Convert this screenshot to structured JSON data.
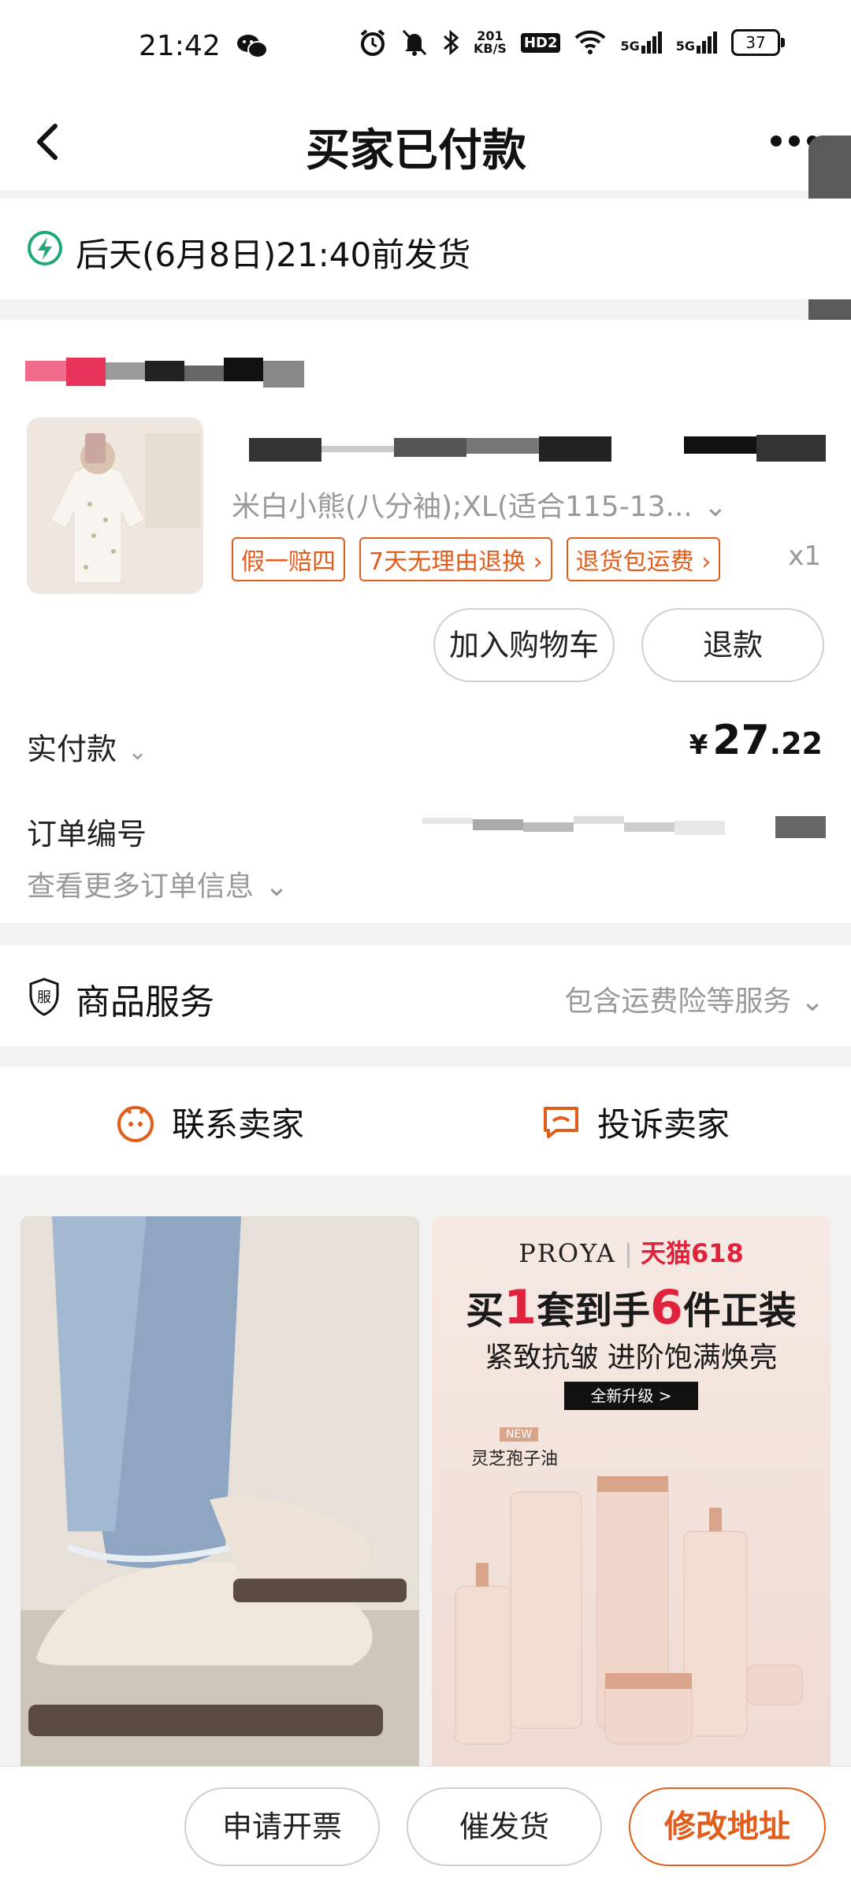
{
  "status_bar": {
    "time": "21:42",
    "net_speed": "201\nKB/S",
    "hd_badge": "HD2",
    "signal1": "5G",
    "signal2": "5G",
    "battery": "37"
  },
  "nav": {
    "title": "买家已付款"
  },
  "shipping": {
    "text": "后天(6月8日)21:40前发货"
  },
  "order": {
    "sku": "米白小熊(八分袖);XL(适合115-13...",
    "tags": [
      "假一赔四",
      "7天无理由退换",
      "退货包运费"
    ],
    "tag_arrows": [
      "",
      "›",
      "›"
    ],
    "quantity": "x1",
    "add_to_cart_label": "加入购物车",
    "refund_label": "退款",
    "paid_label": "实付款",
    "paid_currency": "¥",
    "paid_integer": "27",
    "paid_decimal": ".22",
    "order_no_label": "订单编号",
    "more_info_label": "查看更多订单信息"
  },
  "service": {
    "label": "商品服务",
    "summary": "包含运费险等服务"
  },
  "contact": {
    "contact_seller": "联系卖家",
    "complain_seller": "投诉卖家"
  },
  "recommendations": {
    "item2": {
      "brand": "PROYA",
      "event": "天猫618",
      "headline_parts": [
        "买",
        "1",
        "套到手",
        "6",
        "件正装"
      ],
      "subline": "紧致抗皱 进阶饱满焕亮",
      "cta": "全新升级 >",
      "badge_new": "NEW",
      "product_name": "灵芝孢子油"
    }
  },
  "bottom_bar": {
    "invoice": "申请开票",
    "urge": "催发货",
    "change_address": "修改地址"
  },
  "colors": {
    "accent": "#e05d1c",
    "bolt_green": "#1fa67a"
  }
}
